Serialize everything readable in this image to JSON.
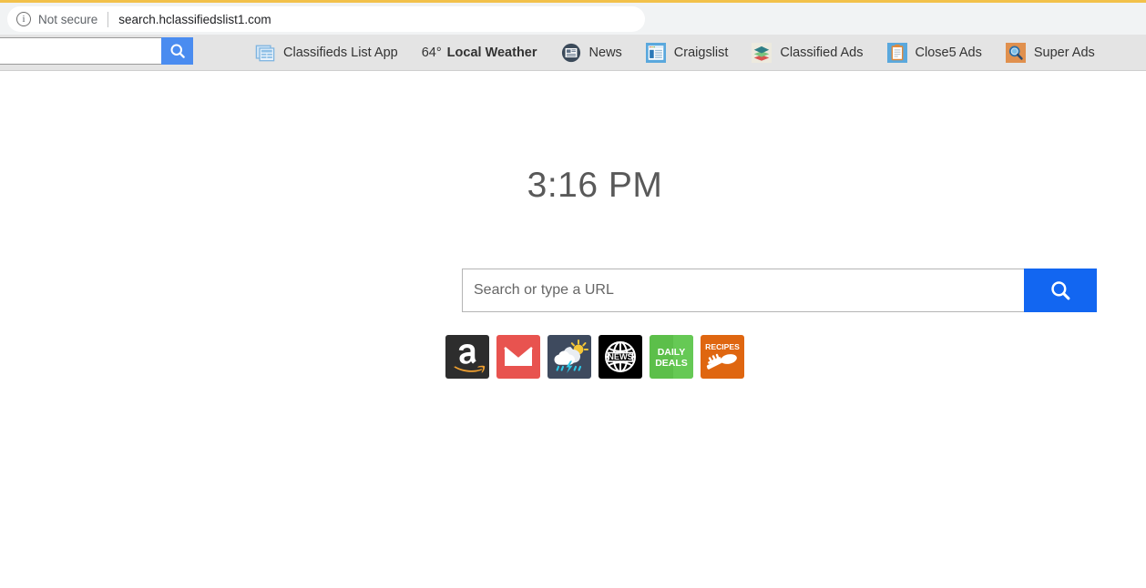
{
  "browser": {
    "security_label": "Not secure",
    "url": "search.hclassifiedslist1.com",
    "info_icon": "info-circle-icon",
    "accent_warning": "#f2c14a"
  },
  "site_toolbar": {
    "search_placeholder": "",
    "search_value": "",
    "search_button_icon": "search-icon",
    "search_button_color": "#4a8cf0",
    "links": [
      {
        "label": "Classifieds List App",
        "icon": "newspaper-grid-icon"
      },
      {
        "label": "Local Weather",
        "temp": "64°",
        "icon": "weather-text-icon"
      },
      {
        "label": "News",
        "icon": "news-circle-icon"
      },
      {
        "label": "Craigslist",
        "icon": "browser-window-icon"
      },
      {
        "label": "Classified Ads",
        "icon": "layers-stack-icon"
      },
      {
        "label": "Close5 Ads",
        "icon": "clipboard-icon"
      },
      {
        "label": "Super Ads",
        "icon": "magnifier-square-icon"
      }
    ]
  },
  "main": {
    "clock": "3:16 PM",
    "search": {
      "placeholder": "Search or type a URL",
      "value": "",
      "button_icon": "search-icon",
      "button_color": "#1266f1"
    },
    "tiles": [
      {
        "name": "amazon",
        "label": "",
        "icon": "amazon-icon",
        "bg": "#2d2d2d"
      },
      {
        "name": "email",
        "label": "",
        "icon": "envelope-icon",
        "bg": "#e8534f"
      },
      {
        "name": "weather",
        "label": "",
        "icon": "storm-cloud-sun-icon",
        "bg": "#3e4a5e"
      },
      {
        "name": "news",
        "label": "NEWS",
        "icon": "globe-news-icon",
        "bg": "#000000"
      },
      {
        "name": "daily-deals",
        "label": "DAILY DEALS",
        "icon": "daily-deals-icon",
        "bg": "#5cbf4a"
      },
      {
        "name": "recipes",
        "label": "RECIPES",
        "icon": "recipes-icon",
        "bg": "#df6610"
      }
    ]
  }
}
